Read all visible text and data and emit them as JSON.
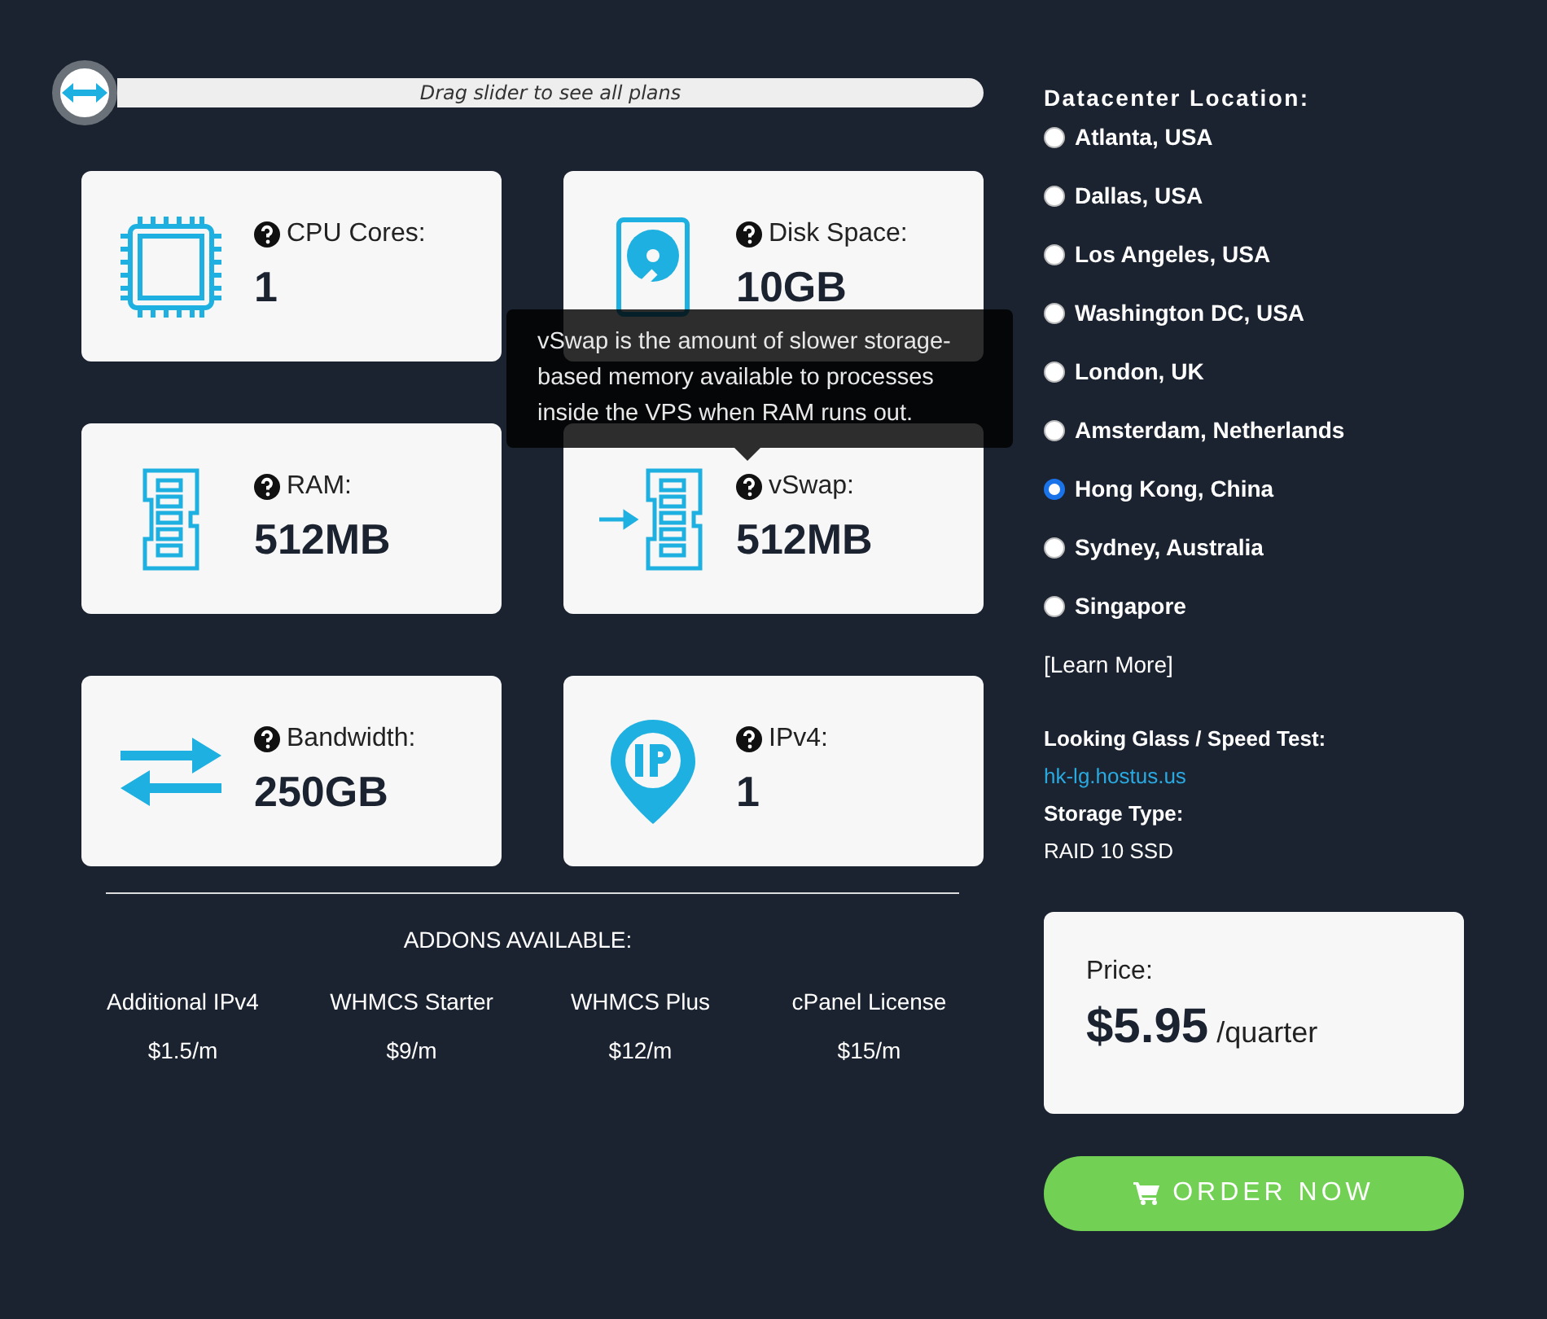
{
  "slider": {
    "label": "Drag slider to see all plans",
    "level": 0
  },
  "specs": [
    {
      "kind": "cpu",
      "label": "CPU Cores:",
      "value": "1"
    },
    {
      "kind": "disk",
      "label": "Disk Space:",
      "value": "10GB"
    },
    {
      "kind": "ram",
      "label": "RAM:",
      "value": "512MB"
    },
    {
      "kind": "vswap",
      "label": "vSwap:",
      "value": "512MB"
    },
    {
      "kind": "bandwidth",
      "label": "Bandwidth:",
      "value": "250GB"
    },
    {
      "kind": "ip",
      "label": "IPv4:",
      "value": "1"
    }
  ],
  "tooltip": {
    "text": "vSwap is the amount of slower storage-based memory available to processes inside the VPS when RAM runs out."
  },
  "addons": {
    "title": "ADDONS AVAILABLE:",
    "items": [
      {
        "name": "Additional IPv4",
        "price": "$1.5/m"
      },
      {
        "name": "WHMCS Starter",
        "price": "$9/m"
      },
      {
        "name": "WHMCS Plus",
        "price": "$12/m"
      },
      {
        "name": "cPanel License",
        "price": "$15/m"
      }
    ]
  },
  "datacenter": {
    "title": "Datacenter Location:",
    "locations": [
      {
        "label": "Atlanta, USA",
        "selected": false
      },
      {
        "label": "Dallas, USA",
        "selected": false
      },
      {
        "label": "Los Angeles, USA",
        "selected": false
      },
      {
        "label": "Washington DC, USA",
        "selected": false
      },
      {
        "label": "London, UK",
        "selected": false
      },
      {
        "label": "Amsterdam, Netherlands",
        "selected": false
      },
      {
        "label": "Hong Kong, China",
        "selected": true
      },
      {
        "label": "Sydney, Australia",
        "selected": false
      },
      {
        "label": "Singapore",
        "selected": false
      }
    ],
    "learn_more": "[Learn More]"
  },
  "looking_glass": {
    "label": "Looking Glass / Speed Test:",
    "link": "hk-lg.hostus.us"
  },
  "storage": {
    "label": "Storage Type:",
    "value": "RAID 10 SSD"
  },
  "price": {
    "label": "Price:",
    "amount": "$5.95",
    "period": "/quarter"
  },
  "order_button": "ORDER NOW"
}
